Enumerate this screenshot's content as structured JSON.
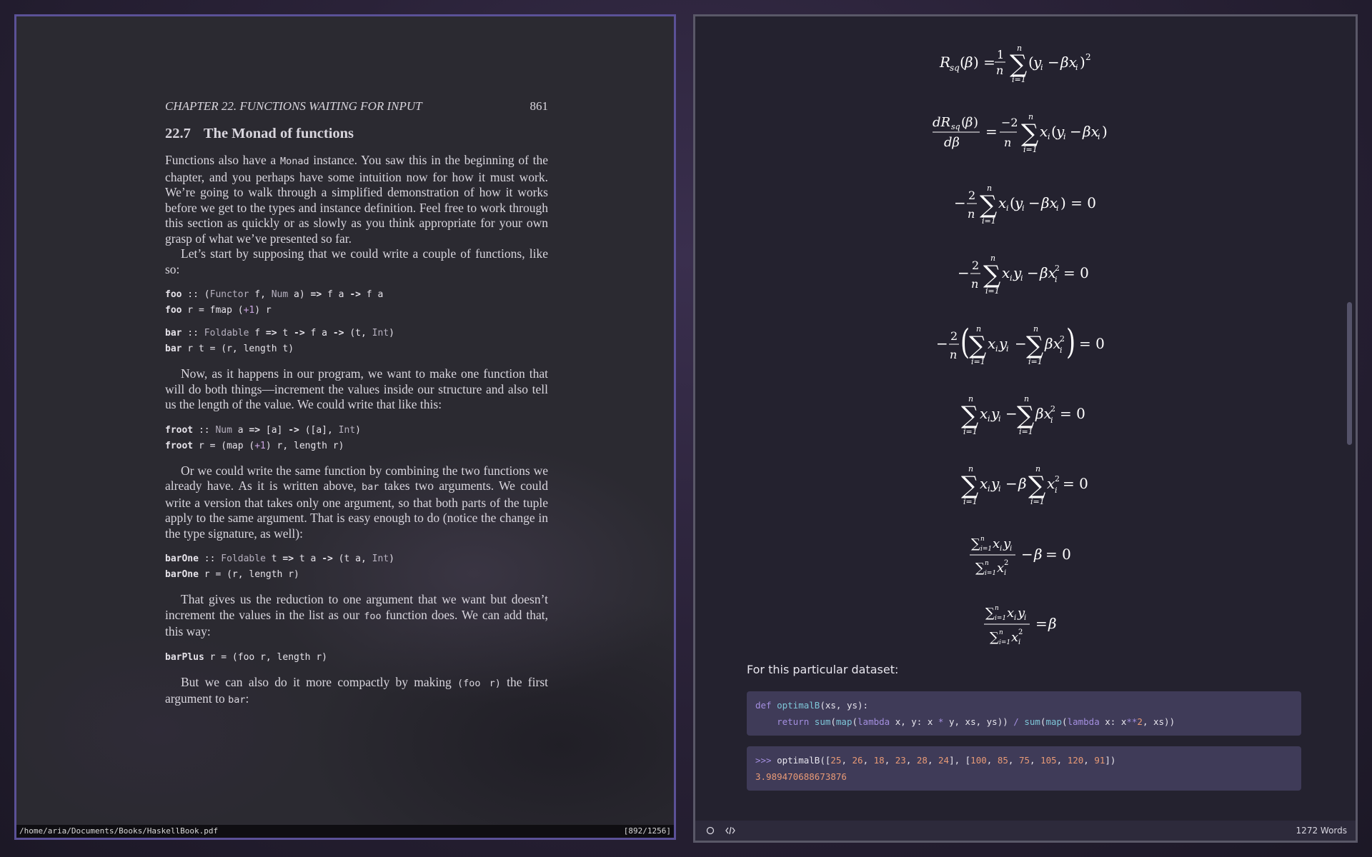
{
  "pdf_viewer": {
    "running_head": {
      "chapter": "CHAPTER 22.  FUNCTIONS WAITING FOR INPUT",
      "page_number": "861"
    },
    "section": {
      "number": "22.7",
      "title": "The Monad of functions"
    },
    "p1": {
      "a": "Functions also have a ",
      "code": "Monad",
      "b": " instance. You saw this in the beginning of the chapter, and you perhaps have some intuition now for how it must work. We’re going to walk through a simplified demonstration of how it works before we get to the types and instance definition. Feel free to work through this section as quickly or as slowly as you think appropriate for your own grasp of what we’ve presented so far."
    },
    "p2": "Let’s start by supposing that we could write a couple of functions, like so:",
    "code1": {
      "l1": [
        "foo",
        " :: (",
        "Functor",
        " f, ",
        "Num",
        " a) ",
        "=>",
        " f a ",
        "->",
        " f a"
      ],
      "l2": [
        "foo",
        " r = fmap (",
        "+1",
        ") r"
      ],
      "l3": [
        "bar",
        " :: ",
        "Foldable",
        " f ",
        "=>",
        " t ",
        "->",
        " f a ",
        "->",
        " (t, ",
        "Int",
        ")"
      ],
      "l4": [
        "bar",
        " r t = (r, length t)"
      ]
    },
    "p3": "Now, as it happens in our program, we want to make one function that will do both things—increment the values inside our structure and also tell us the length of the value. We could write that like this:",
    "code2": {
      "l1": [
        "froot",
        " :: ",
        "Num",
        " a ",
        "=>",
        " [a] ",
        "->",
        " ([a], ",
        "Int",
        ")"
      ],
      "l2": [
        "froot",
        " r = (map (",
        "+1",
        ") r, length r)"
      ]
    },
    "p4": {
      "a": "Or we could write the same function by combining the two functions we already have. As it is written above, ",
      "code": "bar",
      "b": " takes two arguments. We could write a version that takes only one argument, so that both parts of the tuple apply to the same argument. That is easy enough to do (notice the change in the type signature, as well):"
    },
    "code3": {
      "l1": [
        "barOne",
        " :: ",
        "Foldable",
        " t ",
        "=>",
        " t a ",
        "->",
        " (t a, ",
        "Int",
        ")"
      ],
      "l2": [
        "barOne",
        " r = (r, length r)"
      ]
    },
    "p5": {
      "a": "That gives us the reduction to one argument that we want but doesn’t increment the values in the list as our ",
      "code": "foo",
      "b": " function does. We can add that, this way:"
    },
    "code4": {
      "l1": [
        "barPlus",
        " r = (foo r, length r)"
      ]
    },
    "p6": {
      "a": "But we can also do it more compactly by making ",
      "code": "(foo r)",
      "b": " the first argument to ",
      "code2": "bar",
      "c": ":"
    },
    "status": {
      "path": "/home/aria/Documents/Books/HaskellBook.pdf",
      "position": "[892/1256]"
    }
  },
  "editor": {
    "dataset_label": "For this particular dataset:",
    "code_def": {
      "l1": [
        "def",
        " ",
        "optimalB",
        "(xs, ys):"
      ],
      "l2": [
        "    ",
        "return",
        " ",
        "sum",
        "(",
        "map",
        "(",
        "lambda",
        " x, y: x ",
        "*",
        " y, xs, ys)) ",
        "/",
        " ",
        "sum",
        "(",
        "map",
        "(",
        "lambda",
        " x: x",
        "**",
        "2",
        ", xs))"
      ]
    },
    "repl": {
      "prompt": ">>>",
      "call": [
        "optimalB([",
        "25",
        ", ",
        "26",
        ", ",
        "18",
        ", ",
        "23",
        ", ",
        "28",
        ", ",
        "24",
        "], [",
        "100",
        ", ",
        "85",
        ", ",
        "75",
        ", ",
        "105",
        ", ",
        "120",
        ", ",
        "91",
        "])"
      ],
      "output": "3.989470688673876"
    },
    "status": {
      "word_count": "1272 Words"
    },
    "icons": [
      "circle-icon",
      "code-icon"
    ]
  }
}
